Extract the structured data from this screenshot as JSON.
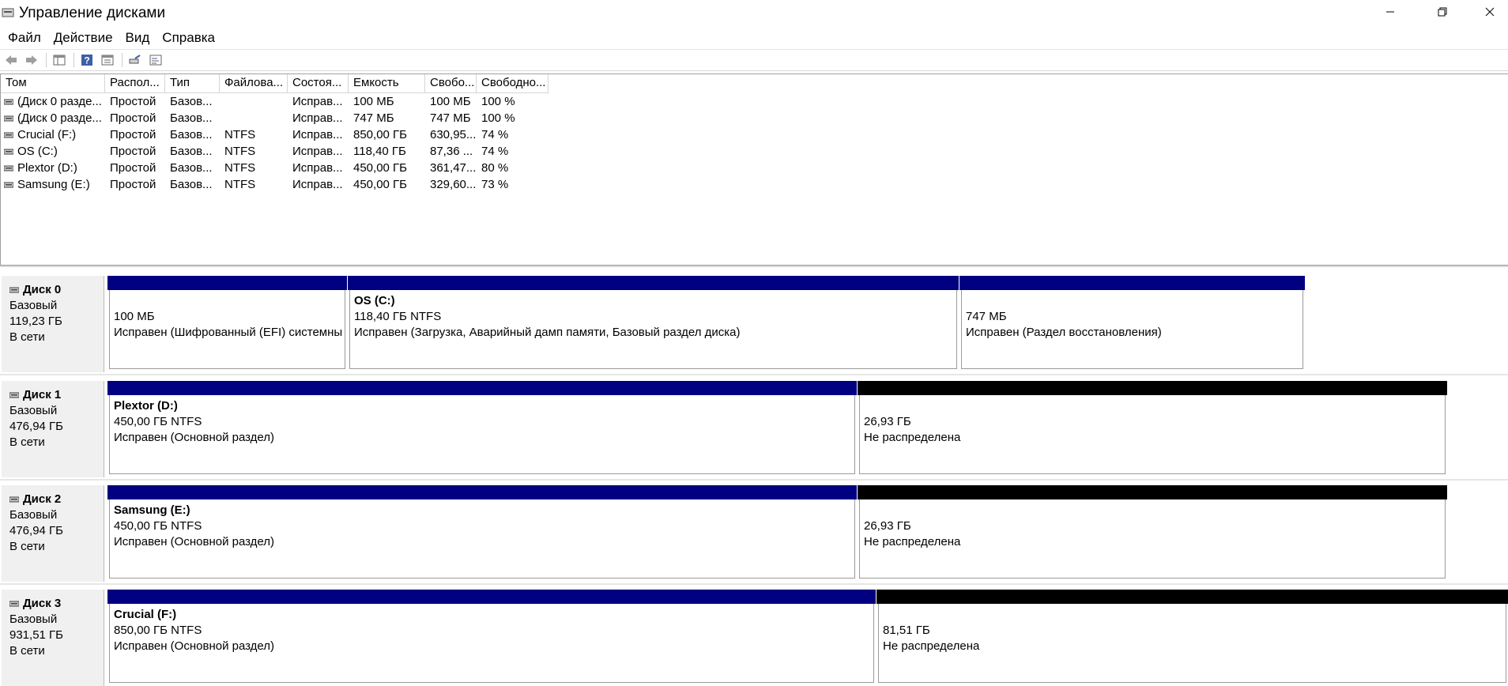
{
  "window": {
    "title": "Управление дисками"
  },
  "menu": [
    "Файл",
    "Действие",
    "Вид",
    "Справка"
  ],
  "toolbar": {
    "icons": [
      "back-arrow-icon",
      "forward-arrow-icon",
      "console-tree-icon",
      "help-icon",
      "properties-icon",
      "rescan-disks-icon",
      "disk-list-icon"
    ]
  },
  "volume_list": {
    "columns": [
      "Том",
      "Распол...",
      "Тип",
      "Файлова...",
      "Состоя...",
      "Емкость",
      "Свобо...",
      "Свободно..."
    ],
    "rows": [
      [
        "(Диск 0 разде...",
        "Простой",
        "Базов...",
        "",
        "Исправ...",
        "100 МБ",
        "100 МБ",
        "100 %"
      ],
      [
        "(Диск 0 разде...",
        "Простой",
        "Базов...",
        "",
        "Исправ...",
        "747 МБ",
        "747 МБ",
        "100 %"
      ],
      [
        "Crucial (F:)",
        "Простой",
        "Базов...",
        "NTFS",
        "Исправ...",
        "850,00 ГБ",
        "630,95...",
        "74 %"
      ],
      [
        "OS (C:)",
        "Простой",
        "Базов...",
        "NTFS",
        "Исправ...",
        "118,40 ГБ",
        "87,36 ...",
        "74 %"
      ],
      [
        "Plextor (D:)",
        "Простой",
        "Базов...",
        "NTFS",
        "Исправ...",
        "450,00 ГБ",
        "361,47...",
        "80 %"
      ],
      [
        "Samsung (E:)",
        "Простой",
        "Базов...",
        "NTFS",
        "Исправ...",
        "450,00 ГБ",
        "329,60...",
        "73 %"
      ]
    ]
  },
  "disks": [
    {
      "name": "Диск 0",
      "type": "Базовый",
      "size": "119,23 ГБ",
      "status": "В сети",
      "partitions": [
        {
          "name": "",
          "size": "100 МБ",
          "status": "Исправен (Шифрованный (EFI) системны",
          "bar": "blue"
        },
        {
          "name": "OS  (C:)",
          "size": "118,40 ГБ NTFS",
          "status": "Исправен (Загрузка, Аварийный дамп памяти, Базовый раздел диска)",
          "bar": "blue"
        },
        {
          "name": "",
          "size": "747 МБ",
          "status": "Исправен (Раздел восстановления)",
          "bar": "blue"
        }
      ]
    },
    {
      "name": "Диск 1",
      "type": "Базовый",
      "size": "476,94 ГБ",
      "status": "В сети",
      "partitions": [
        {
          "name": "Plextor  (D:)",
          "size": "450,00 ГБ NTFS",
          "status": "Исправен (Основной раздел)",
          "bar": "blue"
        },
        {
          "name": "",
          "size": "26,93 ГБ",
          "status": "Не распределена",
          "bar": "black"
        }
      ]
    },
    {
      "name": "Диск 2",
      "type": "Базовый",
      "size": "476,94 ГБ",
      "status": "В сети",
      "partitions": [
        {
          "name": "Samsung  (E:)",
          "size": "450,00 ГБ NTFS",
          "status": "Исправен (Основной раздел)",
          "bar": "blue"
        },
        {
          "name": "",
          "size": "26,93 ГБ",
          "status": "Не распределена",
          "bar": "black"
        }
      ]
    },
    {
      "name": "Диск 3",
      "type": "Базовый",
      "size": "931,51 ГБ",
      "status": "В сети",
      "partitions": [
        {
          "name": "Crucial  (F:)",
          "size": "850,00 ГБ NTFS",
          "status": "Исправен (Основной раздел)",
          "bar": "blue"
        },
        {
          "name": "",
          "size": "81,51 ГБ",
          "status": "Не распределена",
          "bar": "black"
        }
      ]
    }
  ],
  "colors": {
    "primary_partition": "#000080",
    "unallocated": "#000000",
    "disk_label_bg": "#f0f0f0"
  }
}
